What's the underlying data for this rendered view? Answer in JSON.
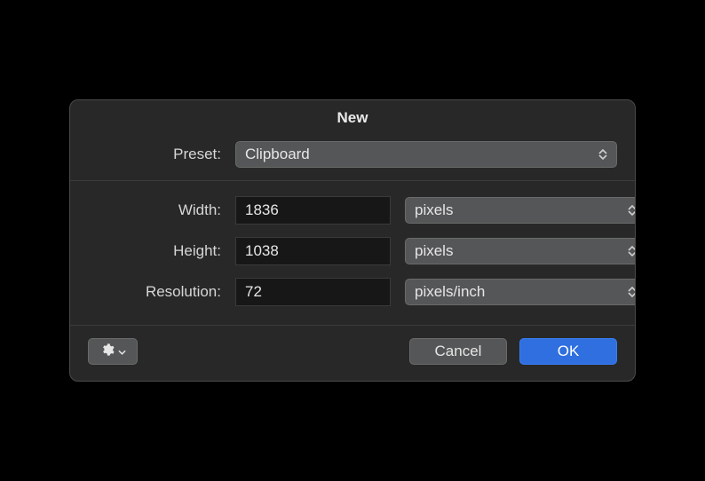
{
  "dialog": {
    "title": "New",
    "preset": {
      "label": "Preset:",
      "value": "Clipboard"
    },
    "width": {
      "label": "Width:",
      "value": "1836",
      "unit": "pixels"
    },
    "height": {
      "label": "Height:",
      "value": "1038",
      "unit": "pixels"
    },
    "resolution": {
      "label": "Resolution:",
      "value": "72",
      "unit": "pixels/inch"
    },
    "buttons": {
      "cancel": "Cancel",
      "ok": "OK"
    }
  }
}
